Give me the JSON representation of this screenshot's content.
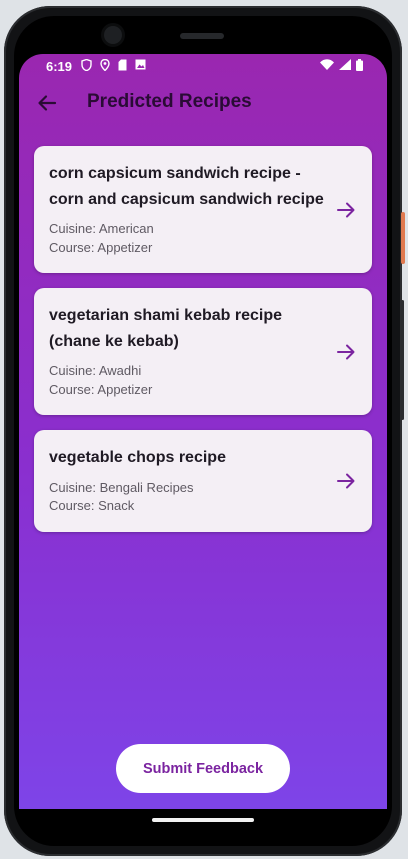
{
  "status_bar": {
    "time": "6:19",
    "left_icons": [
      "shield-icon",
      "location-icon",
      "sim-card-icon",
      "image-icon"
    ],
    "right_icons": [
      "wifi-icon",
      "signal-icon",
      "battery-icon"
    ]
  },
  "app_bar": {
    "title": "Predicted Recipes",
    "back_icon": "arrow-back-icon"
  },
  "recipes": [
    {
      "title": "corn capsicum sandwich recipe - corn and capsicum sandwich recipe",
      "cuisine": "Cuisine: American",
      "course": "Course: Appetizer"
    },
    {
      "title": "vegetarian shami kebab recipe (chane ke kebab)",
      "cuisine": "Cuisine: Awadhi",
      "course": "Course: Appetizer"
    },
    {
      "title": "vegetable chops recipe",
      "cuisine": "Cuisine: Bengali Recipes",
      "course": "Course: Snack"
    }
  ],
  "submit": {
    "label": "Submit Feedback"
  },
  "colors": {
    "gradient_top": "#9a27b0",
    "gradient_bottom": "#7e44e8",
    "card_bg": "#f4eff5",
    "accent": "#7b24a0",
    "title_text": "#2a0b35"
  }
}
